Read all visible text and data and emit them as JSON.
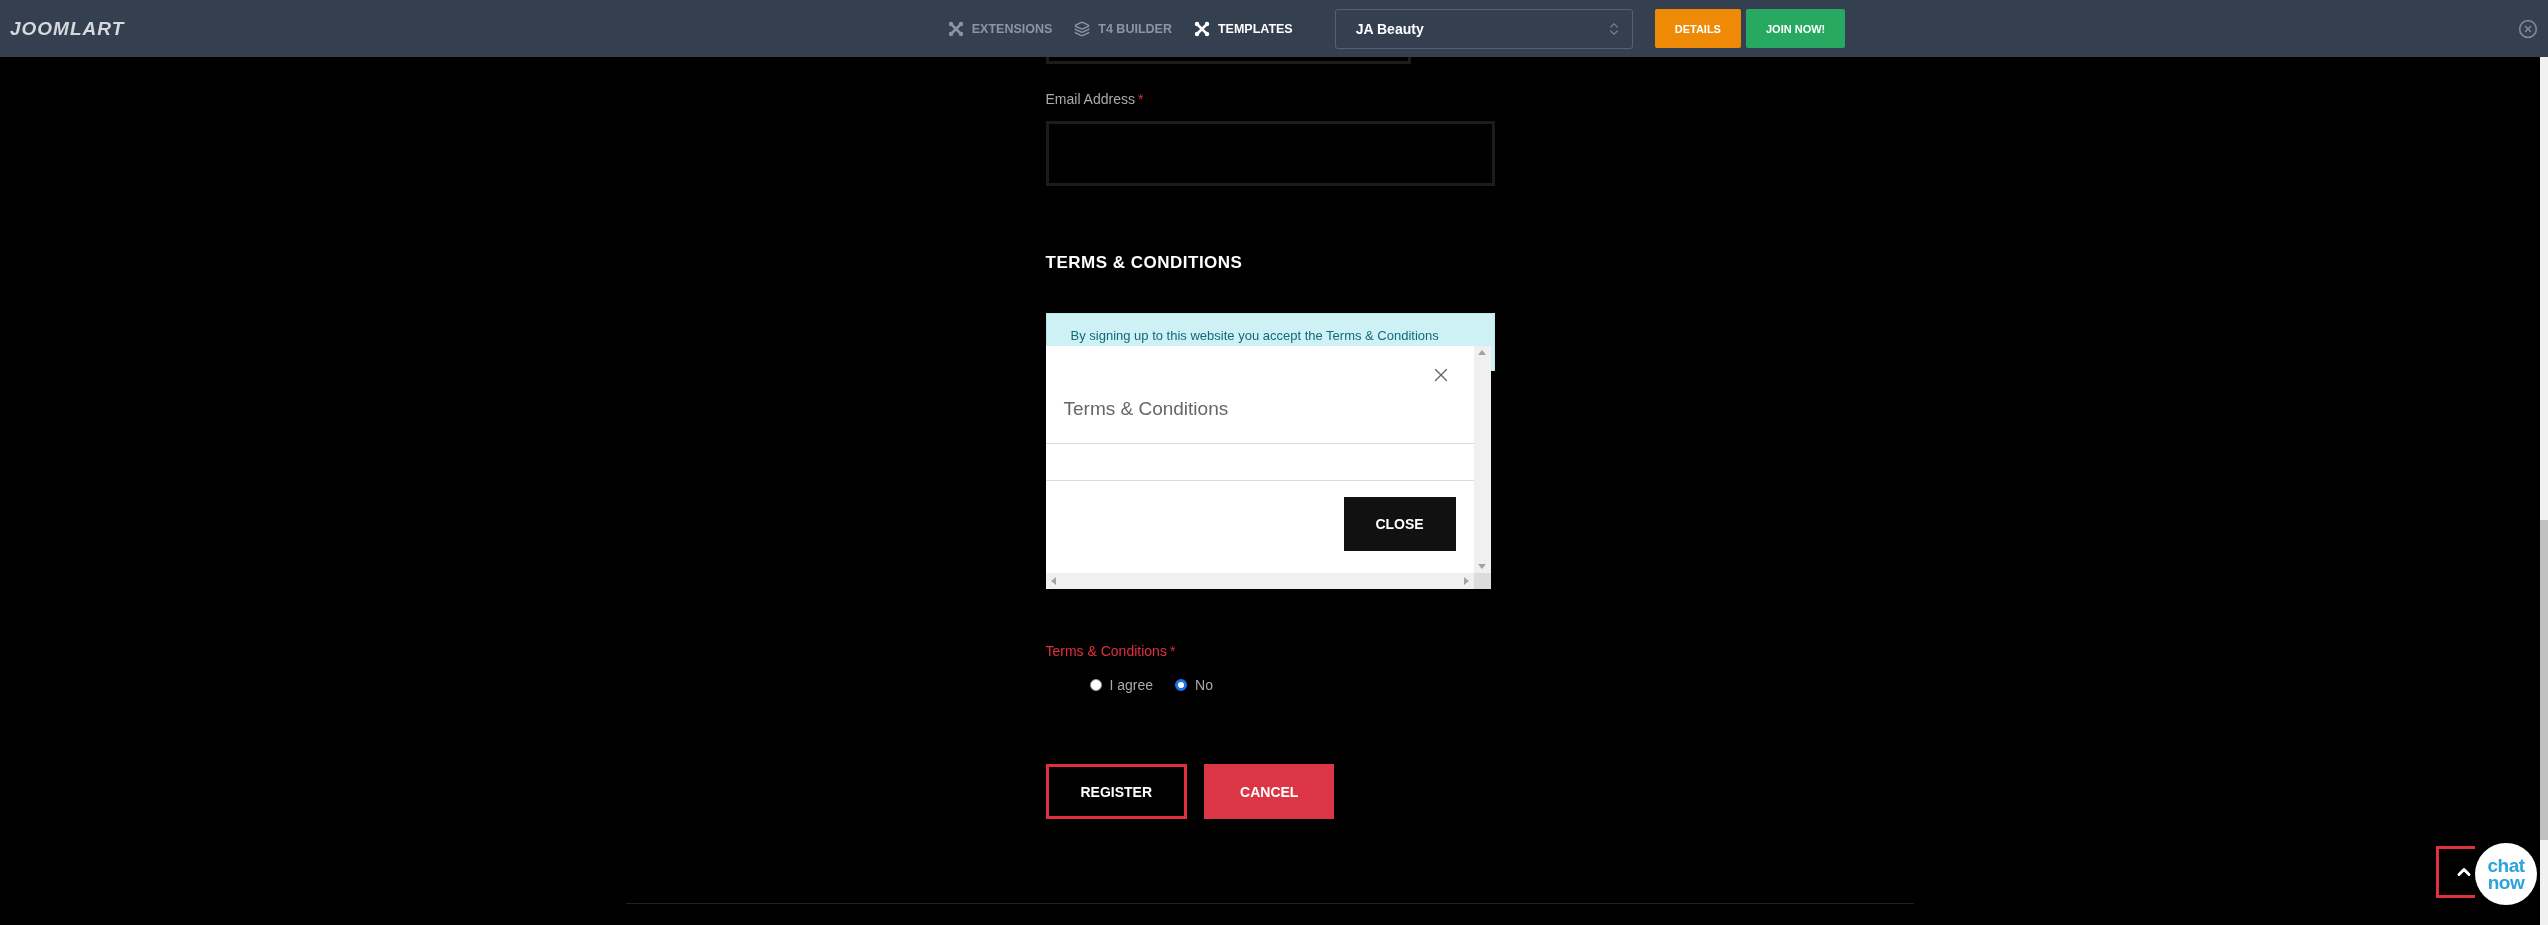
{
  "topbar": {
    "logo": "JOOMLART",
    "nav": [
      {
        "label": "EXTENSIONS",
        "kind": "cross",
        "selected": false
      },
      {
        "label": "T4 BUILDER",
        "kind": "layers",
        "selected": false
      },
      {
        "label": "TEMPLATES",
        "kind": "cross",
        "selected": true
      }
    ],
    "template_select": {
      "value": "JA Beauty"
    },
    "buttons": [
      {
        "label": "DETAILS",
        "kind": "details"
      },
      {
        "label": "JOIN NOW!",
        "kind": "join"
      }
    ]
  },
  "form": {
    "email": {
      "label": "Email Address",
      "required_mark": "*"
    },
    "section_title": "TERMS & CONDITIONS",
    "notice": "By signing up to this website you accept the Terms & Conditions",
    "modal": {
      "title": "Terms & Conditions",
      "button": "CLOSE"
    },
    "terms": {
      "label": "Terms & Conditions",
      "required_mark": "*",
      "options": [
        {
          "label": "I agree",
          "selected": false
        },
        {
          "label": "No",
          "selected": true
        }
      ]
    },
    "buttons": [
      {
        "label": "REGISTER",
        "kind": "outline"
      },
      {
        "label": "CANCEL",
        "kind": "filled"
      }
    ]
  },
  "chat": {
    "label": "chat now"
  }
}
